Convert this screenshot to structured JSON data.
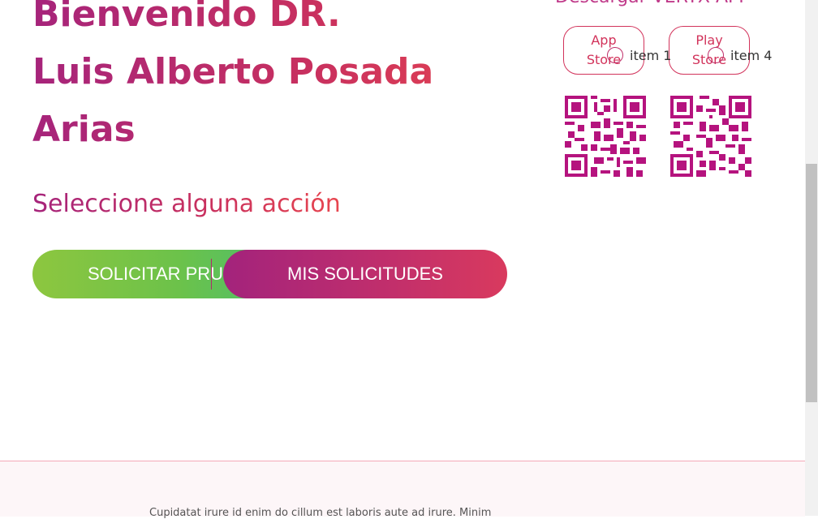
{
  "header": {
    "welcome_line1": "Bienvenido DR.",
    "welcome_line2": "Luis Alberto Posada",
    "welcome_line3": "Arias",
    "subtitle": "Seleccione alguna acción"
  },
  "actions": {
    "solicitar_label": "SOLICITAR PRU",
    "mis_solicitudes_label": "MIS SOLICITUDES"
  },
  "download": {
    "title": "Descargar VERYX APP",
    "app_store_label": "App Store",
    "play_store_label": "Play Store",
    "app_qr_icon": "qr-code-icon",
    "play_qr_icon": "qr-code-icon"
  },
  "footer": {
    "text": "Cupidatat irure id enim do cillum est laboris aute ad irure. Minim",
    "option1": "item 1",
    "option2": "item 4"
  },
  "colors": {
    "brand_magenta": "#a6247b",
    "brand_red": "#e8464f",
    "green": "#8dc63f",
    "qr": "#b5137e"
  }
}
